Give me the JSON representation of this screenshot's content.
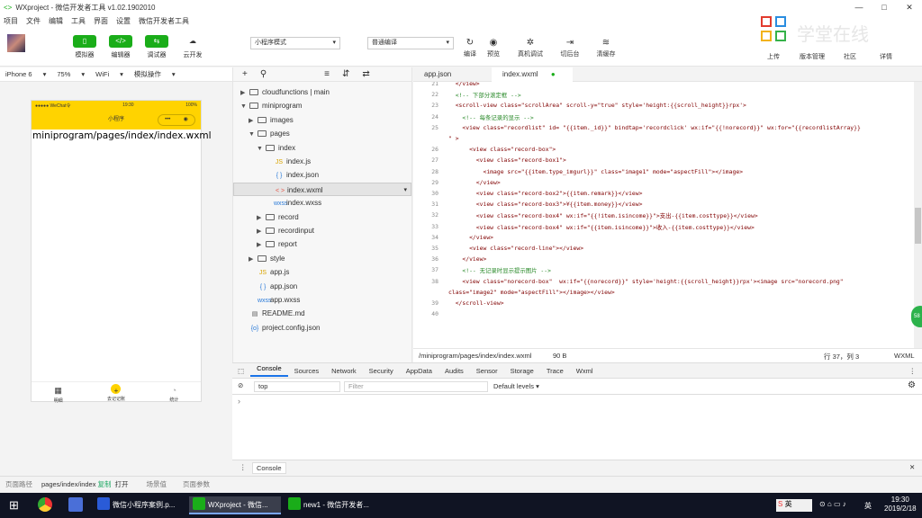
{
  "window": {
    "title": "WXproject - 微信开发者工具 v1.02.1902010",
    "controls": [
      "—",
      "□",
      "✕"
    ]
  },
  "menu": [
    "项目",
    "文件",
    "编辑",
    "工具",
    "界面",
    "设置",
    "微信开发者工具"
  ],
  "toolbar": {
    "buttons": [
      {
        "icon": "phone-icon",
        "glyph": "▯",
        "label": "模拟器"
      },
      {
        "icon": "code-icon",
        "glyph": "</>",
        "label": "编辑器"
      },
      {
        "icon": "debug-icon",
        "glyph": "⇆",
        "label": "调试器"
      },
      {
        "icon": "cloud-icon",
        "glyph": "☁",
        "label": "云开发"
      }
    ],
    "mode": "小程序模式",
    "compile": "普通编译",
    "actions": [
      {
        "glyph": "↻",
        "label": "编译"
      },
      {
        "glyph": "◉",
        "label": "预览"
      },
      {
        "glyph": "✲",
        "label": "真机调试"
      },
      {
        "glyph": "⇥",
        "label": "切后台"
      },
      {
        "glyph": "≋",
        "label": "清缓存"
      }
    ],
    "right": [
      "上传",
      "版本管理",
      "社区",
      "详情"
    ]
  },
  "logo": {
    "text": "学堂在线"
  },
  "device": {
    "model": "iPhone 6",
    "zoom": "75%",
    "network": "WiFi",
    "op": "模拟操作"
  },
  "simulator": {
    "carrier": "●●●●● WeChat令",
    "time": "19:30",
    "battery": "100%",
    "nav_title": "小程序",
    "capsule_more": "•••",
    "capsule_close": "◉",
    "content": "miniprogram/pages/index/index.wxml",
    "tabs": [
      {
        "icon": "▦",
        "label": "明细"
      },
      {
        "icon": "+",
        "label": "去记记账"
      },
      {
        "icon": "◔",
        "label": "统计"
      }
    ]
  },
  "tree": {
    "toolbar": [
      "+",
      "⚲",
      "≡",
      "⇵",
      "⇄"
    ],
    "items": [
      {
        "arrow": "▶",
        "kind": "folder",
        "name": "cloudfunctions | main"
      },
      {
        "arrow": "▼",
        "kind": "folder",
        "name": "miniprogram"
      },
      {
        "arrow": "▶",
        "kind": "folder",
        "name": "images"
      },
      {
        "arrow": "▼",
        "kind": "folder",
        "name": "pages"
      },
      {
        "arrow": "▼",
        "kind": "folder",
        "name": "index"
      },
      {
        "arrow": "",
        "kind": "js",
        "icon": "JS",
        "name": "index.js"
      },
      {
        "arrow": "",
        "kind": "json",
        "icon": "{ }",
        "name": "index.json"
      },
      {
        "arrow": "",
        "kind": "wxml",
        "icon": "< >",
        "name": "index.wxml"
      },
      {
        "arrow": "",
        "kind": "wxss",
        "icon": "wxss",
        "name": "index.wxss"
      },
      {
        "arrow": "▶",
        "kind": "folder",
        "name": "record"
      },
      {
        "arrow": "▶",
        "kind": "folder",
        "name": "recordinput"
      },
      {
        "arrow": "▶",
        "kind": "folder",
        "name": "report"
      },
      {
        "arrow": "▶",
        "kind": "folder",
        "name": "style"
      },
      {
        "arrow": "",
        "kind": "js",
        "icon": "JS",
        "name": "app.js"
      },
      {
        "arrow": "",
        "kind": "json",
        "icon": "{ }",
        "name": "app.json"
      },
      {
        "arrow": "",
        "kind": "wxss",
        "icon": "wxss",
        "name": "app.wxss"
      },
      {
        "arrow": "",
        "kind": "md",
        "icon": "▤",
        "name": "README.md"
      },
      {
        "arrow": "",
        "kind": "json",
        "icon": "{o}",
        "name": "project.config.json"
      }
    ]
  },
  "editor": {
    "tabs": [
      "app.json",
      "index.wxml"
    ],
    "lines": [
      {
        "n": "21",
        "t": "  </view>"
      },
      {
        "n": "22",
        "t": "  <!-- 下部分滚定框 -->"
      },
      {
        "n": "23",
        "t": "  <scroll-view class=\"scrollArea\" scroll-y=\"true\" style='height:{{scroll_height}}rpx'>"
      },
      {
        "n": "24",
        "t": "    <!-- 每条记录的显示 -->"
      },
      {
        "n": "25",
        "t": "    <view class=\"recordlist\" id= \"{{item._id}}\" bindtap='recordclick' wx:if=\"{{!norecord}}\" wx:for=\"{{recordlistArray}}"
      },
      {
        "n": "",
        "t": "\" >"
      },
      {
        "n": "26",
        "t": "      <view class=\"record-box\">"
      },
      {
        "n": "27",
        "t": "        <view class=\"record-box1\">"
      },
      {
        "n": "28",
        "t": "          <image src=\"{{item.type_imgurl}}\" class=\"image1\" mode=\"aspectFill\"></image>"
      },
      {
        "n": "29",
        "t": "        </view>"
      },
      {
        "n": "30",
        "t": "        <view class=\"record-box2\">{{item.remark}}</view>"
      },
      {
        "n": "31",
        "t": "        <view class=\"record-box3\">¥{{item.money}}</view>"
      },
      {
        "n": "32",
        "t": "        <view class=\"record-box4\" wx:if=\"{{!item.isincome}}\">支出-{{item.costtype}}</view>"
      },
      {
        "n": "33",
        "t": "        <view class=\"record-box4\" wx:if=\"{{item.isincome}}\">收入-{{item.costtype}}</view>"
      },
      {
        "n": "34",
        "t": "      </view>"
      },
      {
        "n": "35",
        "t": "      <view class=\"record-line\"></view>"
      },
      {
        "n": "36",
        "t": "    </view>"
      },
      {
        "n": "37",
        "t": "    <!-- 无记录时显示提示图片 -->"
      },
      {
        "n": "38",
        "t": "    <view class=\"norecord-box\"  wx:if=\"{{norecord}}\" style='height:{{scroll_height}}rpx'><image src=\"norecord.png\""
      },
      {
        "n": "",
        "t": "class=\"image2\" mode=\"aspectFill\"></image></view>"
      },
      {
        "n": "39",
        "t": "  </scroll-view>"
      },
      {
        "n": "40",
        "t": ""
      }
    ],
    "status_path": "/miniprogram/pages/index/index.wxml",
    "status_size": "90 B",
    "status_pos": "行 37，列 3",
    "status_lang": "WXML"
  },
  "devtools": {
    "tabs": [
      "Console",
      "Sources",
      "Network",
      "Security",
      "AppData",
      "Audits",
      "Sensor",
      "Storage",
      "Trace",
      "Wxml"
    ],
    "context": "top",
    "filter_placeholder": "Filter",
    "levels": "Default levels ▾",
    "prompt": "›",
    "bottom_tab": "Console"
  },
  "statusbar": {
    "label": "页面路径",
    "path": "pages/index/index",
    "copy": "复制",
    "open": "打开",
    "scene": "场景值",
    "params": "页面参数"
  },
  "taskbar": {
    "items": [
      "微信小程序案例.p...",
      "WXproject - 微信...",
      "new1 - 微信开发者..."
    ],
    "ime": "英",
    "time": "19:30",
    "date": "2019/2/18",
    "green": "58"
  }
}
